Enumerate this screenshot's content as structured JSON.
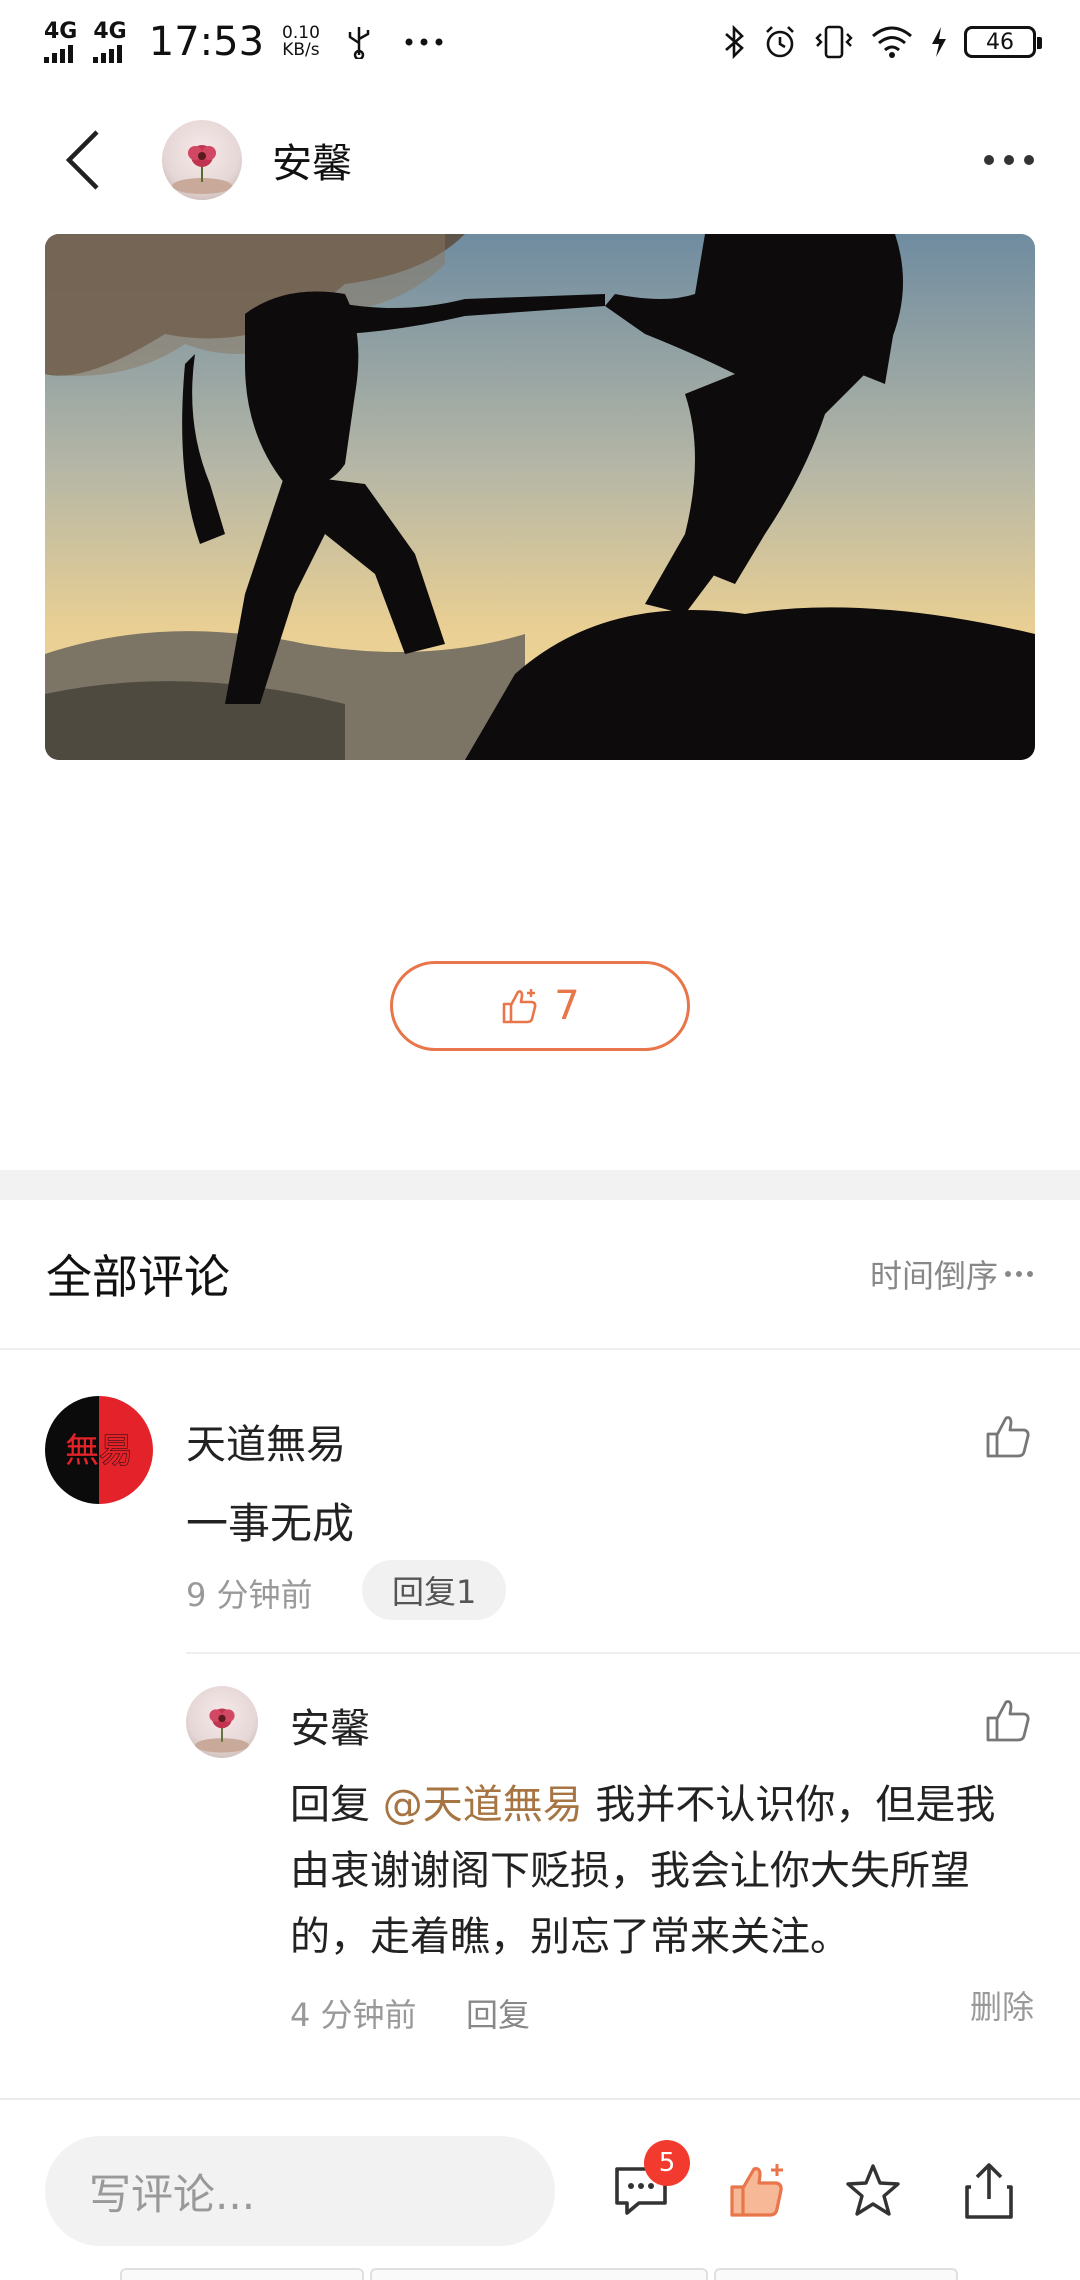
{
  "status_bar": {
    "signal_1": "4G",
    "signal_2": "4G",
    "time": "17:53",
    "net_speed_value": "0.10",
    "net_speed_unit": "KB/s",
    "battery_level": "46"
  },
  "header": {
    "username": "安馨"
  },
  "post": {
    "like_count": "7"
  },
  "comments_section": {
    "title": "全部评论",
    "sort_label": "时间倒序"
  },
  "comment": {
    "avatar_text": "無易",
    "author": "天道無易",
    "text": "一事无成",
    "time": "9 分钟前",
    "reply_chip": "回复1"
  },
  "reply": {
    "author": "安馨",
    "prefix": "回复 ",
    "mention": "@天道無易",
    "text": " 我并不认识你，但是我由衷谢谢阁下贬损，我会让你大失所望的，走着瞧，别忘了常来关注。",
    "time": "4 分钟前",
    "reply_label": "回复",
    "delete_label": "删除"
  },
  "bottom_bar": {
    "input_placeholder": "写评论...",
    "comment_badge": "5"
  },
  "colors": {
    "accent": "#e8764a",
    "mention": "#a67543",
    "badge": "#f23a2f"
  }
}
